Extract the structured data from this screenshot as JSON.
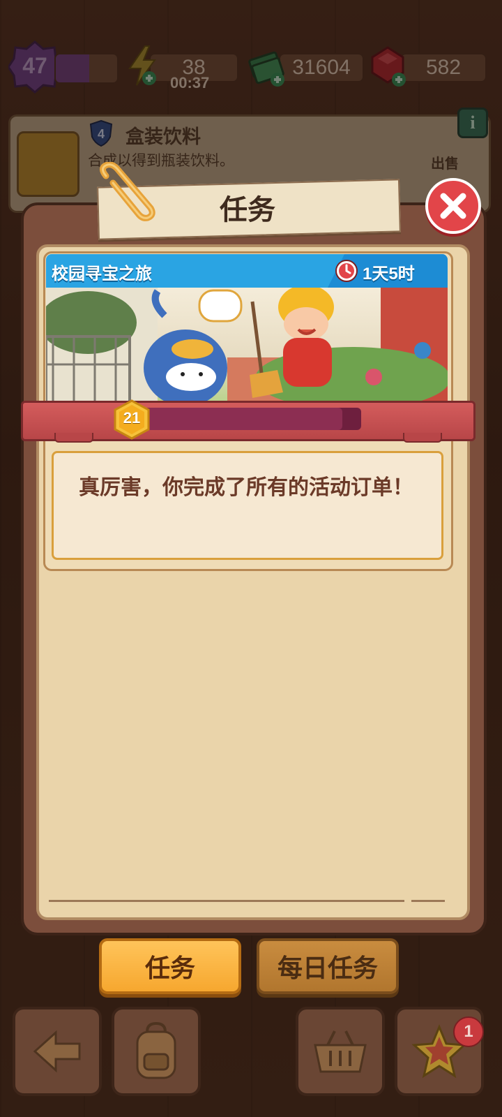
{
  "hud": {
    "level": "47",
    "energy": "38",
    "energy_timer": "00:37",
    "cash": "31604",
    "gems": "582",
    "level_progress": 0.55
  },
  "item_card": {
    "tier": "4",
    "title": "盒装饮料",
    "description": "合成以得到瓶装饮料。",
    "sell_label": "出售",
    "info_label": "i"
  },
  "dialog": {
    "title": "任务",
    "event": {
      "name": "校园寻宝之旅",
      "time_left": "1天5时",
      "level": "21",
      "progress": 0.92
    },
    "message": "真厉害，你完成了所有的活动订单！"
  },
  "tabs": [
    {
      "label": "任务",
      "active": true
    },
    {
      "label": "每日任务",
      "active": false
    }
  ],
  "bottom_nav": {
    "star_badge": "1"
  },
  "colors": {
    "close": "#e24549",
    "event_header": "#2aa4e3",
    "tab_active": "#f6a72f",
    "progress": "#6e1f3e"
  }
}
